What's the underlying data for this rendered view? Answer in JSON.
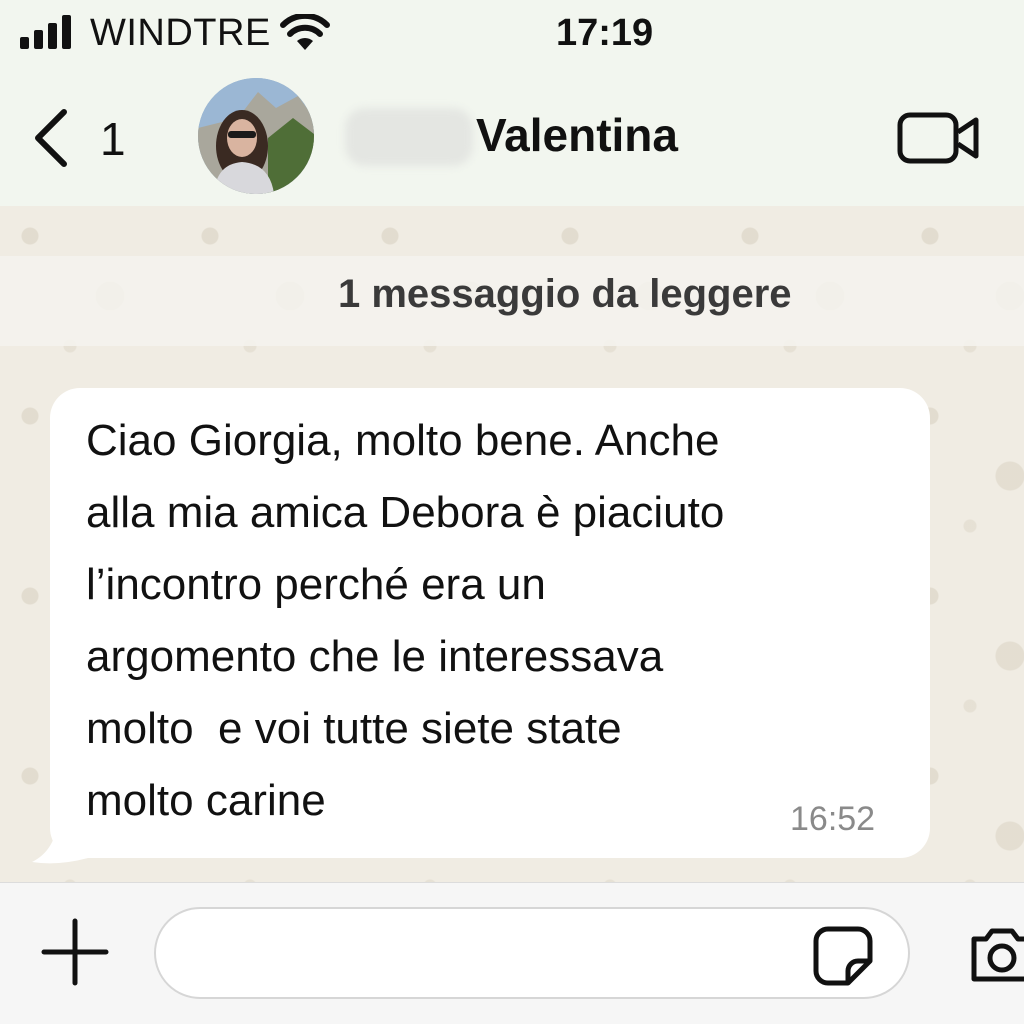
{
  "status_bar": {
    "carrier": "WINDTRE",
    "time": "17:19"
  },
  "header": {
    "back_count": "1",
    "contact_name": "Valentina"
  },
  "chat": {
    "unread_banner": "1 messaggio da leggere",
    "message": {
      "lines": [
        "Ciao Giorgia, molto bene. Anche",
        "alla mia amica Debora è piaciuto",
        "l’incontro perché era un",
        "argomento che le interessava",
        "molto  e voi tutte siete state",
        "molto carine"
      ],
      "time": "16:52"
    }
  },
  "input_bar": {
    "message_value": ""
  }
}
